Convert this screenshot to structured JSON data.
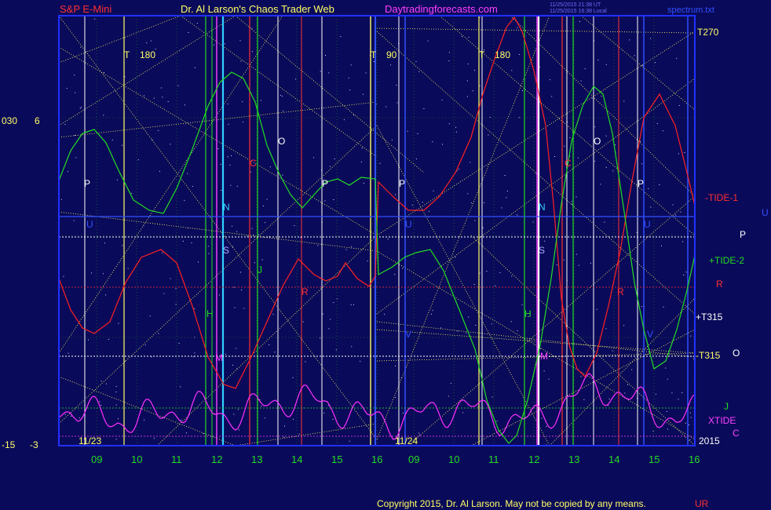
{
  "header": {
    "instrument": "S&P E-Mini",
    "brand": "Dr. Al Larson's Chaos Trader Web",
    "site": "Daytradingforecasts.com",
    "stamp1": "11/25/2015 21:38 UT",
    "stamp2": "11/25/2015 16:38 Local",
    "file": "spectrum.txt"
  },
  "left_axis": {
    "upper_a": "030",
    "upper_b": "6",
    "lower_a": "-15",
    "lower_b": "-3"
  },
  "timing_labels": [
    {
      "t": "T",
      "v": "180"
    },
    {
      "t": "T",
      "v": "90"
    },
    {
      "t": "T",
      "v": "180"
    }
  ],
  "right_labels": {
    "t270": "T270",
    "tide1": "-TIDE-1",
    "u": "U",
    "p": "P",
    "tide2": "+TIDE-2",
    "r": "R",
    "t315p": "+T315",
    "t315m": "-T315",
    "o": "O",
    "j": "J",
    "xtide": "XTIDE",
    "year": "2015",
    "c": "C"
  },
  "date_labels": [
    "11/23",
    "11/24"
  ],
  "hour_ticks": [
    "09",
    "10",
    "11",
    "12",
    "13",
    "14",
    "15",
    "16",
    "09",
    "10",
    "11",
    "12",
    "13",
    "14",
    "15",
    "16"
  ],
  "markers": {
    "P": "P",
    "N": "N",
    "S": "S",
    "O": "O",
    "C": "C",
    "H": "H",
    "J": "J",
    "M": "M",
    "R": "R",
    "U": "U",
    "V": "V"
  },
  "footer": {
    "copyright": "Copyright 2015, Dr. Al Larson. May not be copied by any means.",
    "suffix": "UR"
  },
  "colors": {
    "background": "#0a0a5a",
    "frame": "#2030ff",
    "tide1": "#ff2020",
    "tide2": "#22dd22",
    "xtide": "#ff30ff",
    "fib": "#ffff66",
    "header_red": "#ff3030",
    "header_yellow": "#ffff66",
    "header_magenta": "#ff40ff",
    "hour_green": "#22dd22"
  },
  "chart_data": {
    "type": "line",
    "series": [
      {
        "name": "-TIDE-1"
      },
      {
        "name": "+TIDE-2"
      },
      {
        "name": "XTIDE"
      }
    ],
    "x_ticks": [
      "09",
      "10",
      "11",
      "12",
      "13",
      "14",
      "15",
      "16",
      "09",
      "10",
      "11",
      "12",
      "13",
      "14",
      "15",
      "16"
    ]
  }
}
